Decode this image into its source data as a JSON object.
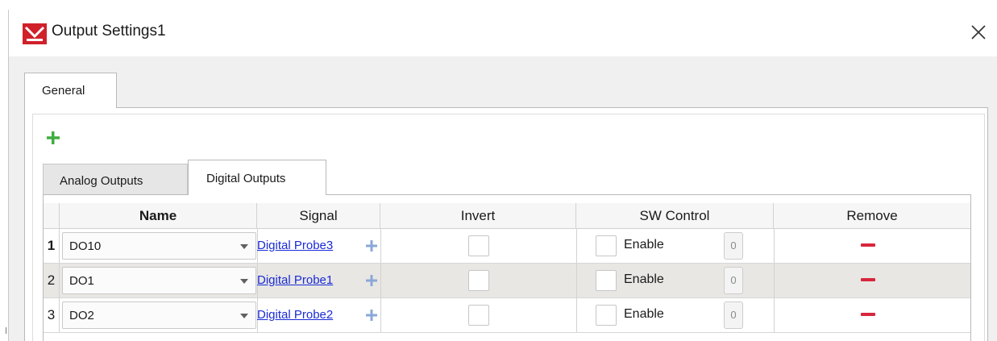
{
  "window": {
    "title": "Output Settings1",
    "close_glyph": "✕",
    "app_icon": "app-logo-icon"
  },
  "tabs": {
    "general_label": "General"
  },
  "toolbar": {
    "add_icon": "plus-icon",
    "add_color": "#3fae3f"
  },
  "subtabs": {
    "analog_label": "Analog Outputs",
    "digital_label": "Digital Outputs",
    "active": "Digital Outputs"
  },
  "table": {
    "headers": {
      "name": "Name",
      "signal": "Signal",
      "invert": "Invert",
      "sw_control": "SW Control",
      "remove": "Remove"
    },
    "rows": [
      {
        "num": "1",
        "name": "DO10",
        "signal": "Digital Probe3",
        "invert": false,
        "sw_enable": false,
        "enable_label": "Enable",
        "sw_value": "0"
      },
      {
        "num": "2",
        "name": "DO1",
        "signal": "Digital Probe1",
        "invert": false,
        "sw_enable": false,
        "enable_label": "Enable",
        "sw_value": "0"
      },
      {
        "num": "3",
        "name": "DO2",
        "signal": "Digital Probe2",
        "invert": false,
        "sw_enable": false,
        "enable_label": "Enable",
        "sw_value": "0"
      }
    ]
  },
  "colors": {
    "link": "#1a2bd6",
    "remove": "#d7263d",
    "brand": "#d0202a"
  }
}
